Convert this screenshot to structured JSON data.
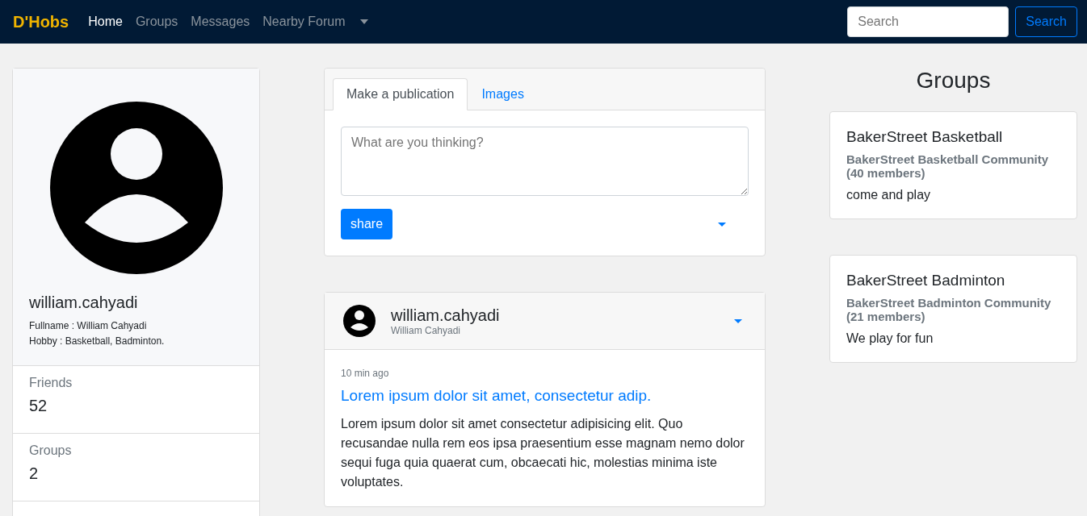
{
  "navbar": {
    "brand": "D'Hobs",
    "links": [
      {
        "label": "Home",
        "selected": true
      },
      {
        "label": "Groups",
        "selected": false
      },
      {
        "label": "Messages",
        "selected": false
      },
      {
        "label": "Nearby Forum",
        "selected": false
      }
    ],
    "search": {
      "placeholder": "Search"
    },
    "search_button": "Search"
  },
  "profile": {
    "username": "william.cahyadi",
    "details": [
      "Fullname : William Cahyadi",
      "Hobby : Basketball, Badminton."
    ],
    "stats": [
      {
        "label": "Friends",
        "value": "52"
      },
      {
        "label": "Groups",
        "value": "2"
      }
    ]
  },
  "composer": {
    "tabs": [
      {
        "label": "Make a publication",
        "selected": true
      },
      {
        "label": "Images",
        "selected": false
      }
    ],
    "placeholder": "What are you thinking?",
    "button": "share"
  },
  "post": {
    "username": "william.cahyadi",
    "fullname": "William Cahyadi",
    "time": "10 min ago",
    "title": "Lorem ipsum dolor sit amet, consectetur adip.",
    "body": "Lorem ipsum dolor sit amet consectetur adipisicing elit. Quo recusandae nulla rem eos ipsa praesentium esse magnam nemo dolor sequi fuga quia quaerat cum, obcaecati hic, molestias minima iste voluptates."
  },
  "groups": {
    "heading": "Groups",
    "items": [
      {
        "name": "BakerStreet Basketball",
        "subtitle": "BakerStreet Basketball Community (40 members)",
        "description": "come and play"
      },
      {
        "name": "BakerStreet Badminton",
        "subtitle": "BakerStreet Badminton Community (21 members)",
        "description": "We play for fun"
      }
    ]
  }
}
